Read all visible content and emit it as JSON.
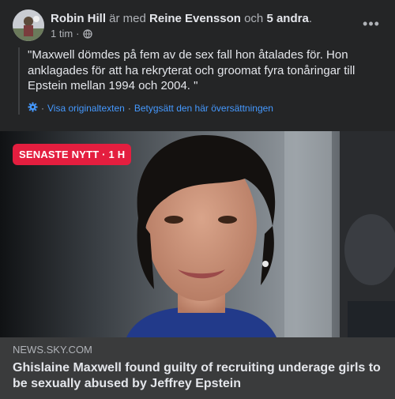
{
  "post": {
    "author": "Robin Hill",
    "with_text": "är med",
    "tagged": "Reine Evensson",
    "and_text": "och",
    "others": "5 andra",
    "period": ".",
    "time": "1 tim",
    "dot": "·",
    "privacy_icon": "globe-icon",
    "more_icon": "more-options-icon",
    "more_label": "•••",
    "quote": "\"Maxwell dömdes på fem av de sex fall hon åtalades för. Hon anklagades för att ha rekryterat och groomat fyra tonåringar till Epstein mellan 1994 och 2004. \"",
    "translate_icon": "gear-icon",
    "see_original": "Visa originaltexten",
    "sep": "·",
    "rate_translation": "Betygsätt den här översättningen"
  },
  "media": {
    "badge": "SENASTE NYTT · 1 H"
  },
  "link": {
    "domain": "NEWS.SKY.COM",
    "title": "Ghislaine Maxwell found guilty of recruiting underage girls to be sexually abused by Jeffrey Epstein"
  },
  "colors": {
    "background": "#242526",
    "link_card": "#3a3b3c",
    "accent": "#4599ff",
    "badge": "#e41e3f"
  }
}
